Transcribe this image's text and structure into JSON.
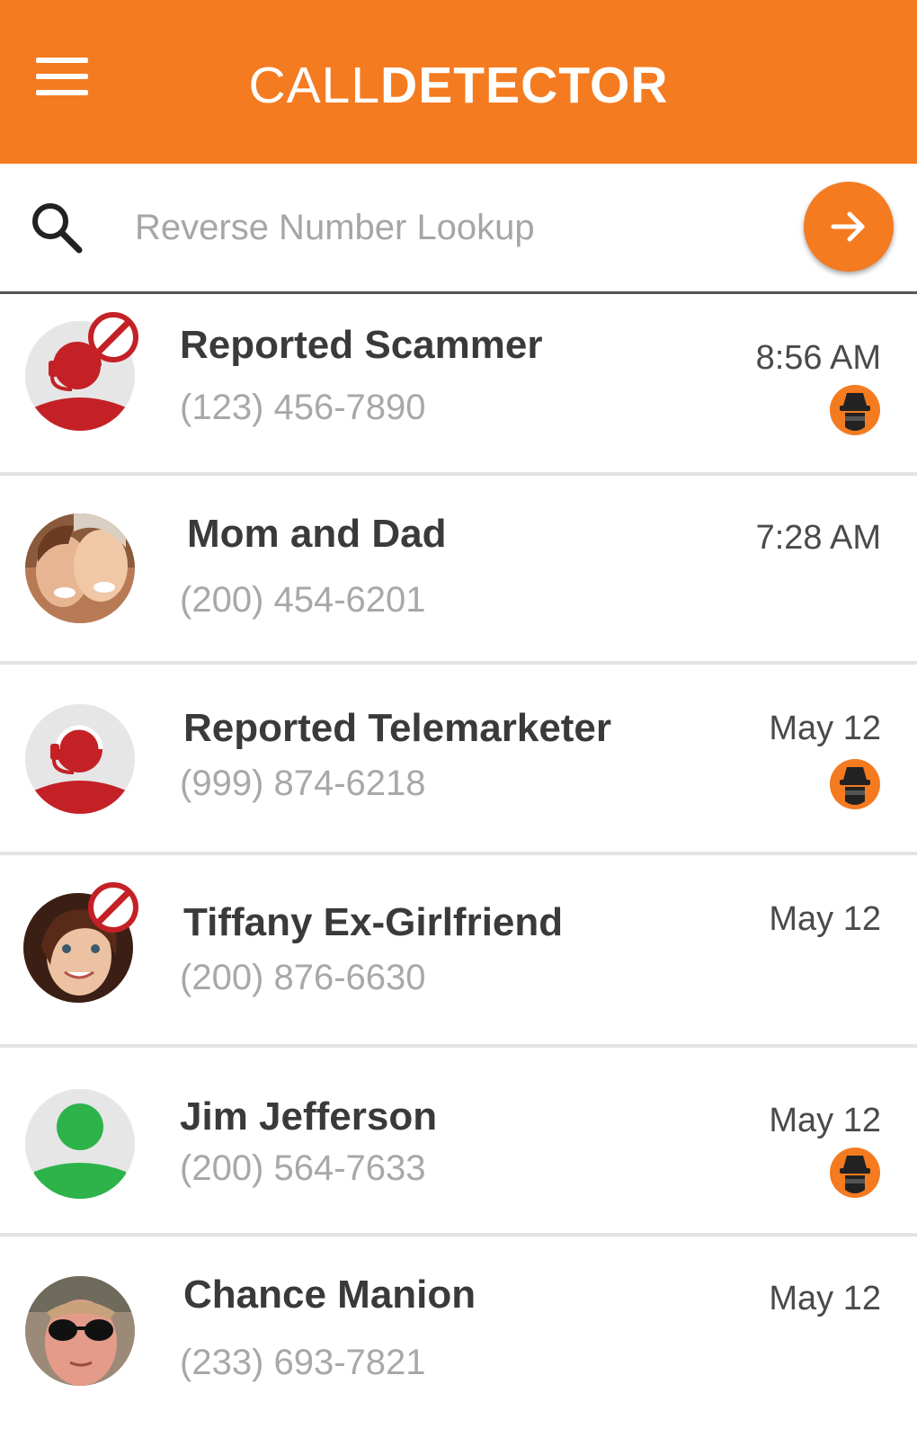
{
  "app": {
    "title_light": "CALL",
    "title_bold": "DETECTOR",
    "accent_color": "#f47b20"
  },
  "search": {
    "placeholder": "Reverse Number Lookup",
    "value": ""
  },
  "calls": [
    {
      "name": "Reported Scammer",
      "phone": "(123) 456-7890",
      "time": "8:56 AM",
      "avatar": "reported-caller-icon",
      "blocked": true,
      "spy_flag": true
    },
    {
      "name": "Mom and Dad",
      "phone": "(200) 454-6201",
      "time": "7:28 AM",
      "avatar": "contact-photo",
      "blocked": false,
      "spy_flag": false
    },
    {
      "name": "Reported Telemarketer",
      "phone": "(999) 874-6218",
      "time": "May 12",
      "avatar": "reported-caller-icon",
      "blocked": false,
      "spy_flag": true
    },
    {
      "name": "Tiffany Ex-Girlfriend",
      "phone": "(200) 876-6630",
      "time": "May 12",
      "avatar": "contact-photo",
      "blocked": true,
      "spy_flag": false
    },
    {
      "name": "Jim Jefferson",
      "phone": "(200) 564-7633",
      "time": "May 12",
      "avatar": "generic-person-icon",
      "blocked": false,
      "spy_flag": true
    },
    {
      "name": "Chance Manion",
      "phone": "(233) 693-7821",
      "time": "May 12",
      "avatar": "contact-photo",
      "blocked": false,
      "spy_flag": false
    }
  ]
}
